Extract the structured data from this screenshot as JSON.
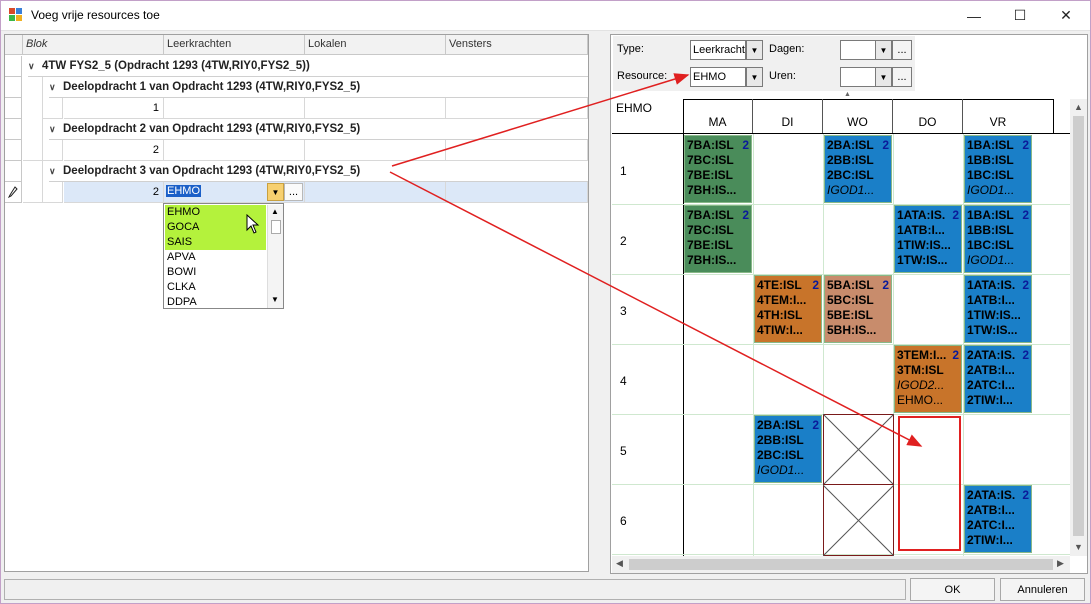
{
  "window": {
    "title": "Voeg vrije resources toe",
    "minimize": "—",
    "maximize": "☐",
    "close": "✕"
  },
  "grid": {
    "columns": [
      "Blok",
      "Leerkrachten",
      "Lokalen",
      "Vensters"
    ],
    "top_group": "4TW FYS2_5 (Opdracht 1293 (4TW,RIY0,FYS2_5))",
    "subgroups": [
      {
        "title": "Deelopdracht 1 van Opdracht 1293 (4TW,RIY0,FYS2_5)",
        "value": "1"
      },
      {
        "title": "Deelopdracht 2 van Opdracht 1293 (4TW,RIY0,FYS2_5)",
        "value": "2"
      },
      {
        "title": "Deelopdracht 3 van Opdracht 1293 (4TW,RIY0,FYS2_5)",
        "value": "2",
        "editor_value": "EHMO"
      }
    ],
    "dropdown_items": [
      "EHMO",
      "GOCA",
      "SAIS",
      "APVA",
      "BOWI",
      "CLKA",
      "DDPA"
    ],
    "ellipsis": "..."
  },
  "filters": {
    "type_label": "Type:",
    "type_value": "Leerkracht",
    "dagen_label": "Dagen:",
    "dagen_value": "",
    "resource_label": "Resource:",
    "resource_value": "EHMO",
    "uren_label": "Uren:",
    "uren_value": "",
    "dots": "..."
  },
  "schedule": {
    "resource": "EHMO",
    "days": [
      "MA",
      "DI",
      "WO",
      "DO",
      "VR"
    ],
    "hours": [
      "1",
      "2",
      "3",
      "4",
      "5",
      "6"
    ],
    "lessons": {
      "l1ma": {
        "lines": [
          "7BA:ISL",
          "7BC:ISL",
          "7BE:ISL",
          "7BH:IS..."
        ],
        "count": "2"
      },
      "l1wo": {
        "lines": [
          "2BA:ISL",
          "2BB:ISL",
          "2BC:ISL"
        ],
        "room": "IGOD1...",
        "count": "2"
      },
      "l1vr": {
        "lines": [
          "1BA:ISL",
          "1BB:ISL",
          "1BC:ISL"
        ],
        "room": "IGOD1...",
        "count": "2"
      },
      "l2ma": {
        "lines": [
          "7BA:ISL",
          "7BC:ISL",
          "7BE:ISL",
          "7BH:IS..."
        ],
        "count": "2"
      },
      "l2do": {
        "lines": [
          "1ATA:IS.",
          "1ATB:I...",
          "1TIW:IS...",
          "1TW:IS..."
        ],
        "count": "2"
      },
      "l2vr": {
        "lines": [
          "1BA:ISL",
          "1BB:ISL",
          "1BC:ISL"
        ],
        "room": "IGOD1...",
        "count": "2"
      },
      "l3di": {
        "lines": [
          "4TE:ISL",
          "4TEM:I...",
          "4TH:ISL",
          "4TIW:I..."
        ],
        "count": "2"
      },
      "l3wo": {
        "lines": [
          "5BA:ISL",
          "5BC:ISL",
          "5BE:ISL",
          "5BH:IS..."
        ],
        "count": "2"
      },
      "l3vr": {
        "lines": [
          "1ATA:IS.",
          "1ATB:I...",
          "1TIW:IS...",
          "1TW:IS..."
        ],
        "count": "2"
      },
      "l4do": {
        "lines": [
          "3TEM:I...",
          "3TM:ISL"
        ],
        "room": "IGOD2...",
        "teacher": "EHMO...",
        "count": "2"
      },
      "l4vr": {
        "lines": [
          "2ATA:IS.",
          "2ATB:I...",
          "2ATC:I...",
          "2TIW:I..."
        ],
        "count": "2"
      },
      "l5di": {
        "lines": [
          "2BA:ISL",
          "2BB:ISL",
          "2BC:ISL"
        ],
        "room": "IGOD1...",
        "count": "2"
      },
      "l6vr": {
        "lines": [
          "2ATA:IS.",
          "2ATB:I...",
          "2ATC:I...",
          "2TIW:I..."
        ],
        "count": "2"
      }
    }
  },
  "colors": {
    "green": "#4a8c5a",
    "blue": "#1a7fc8",
    "orange": "#c8742a",
    "tan": "#c88c6c",
    "highlight": "#b4f23c",
    "arrow": "#e02020"
  },
  "footer": {
    "ok": "OK",
    "cancel": "Annuleren"
  }
}
